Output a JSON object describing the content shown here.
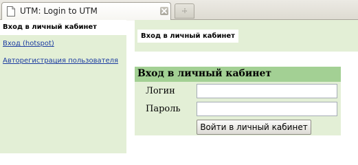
{
  "browser": {
    "tab_title": "UTM: Login to UTM",
    "icons": {
      "tab_icon": "document-icon",
      "close": "close-icon",
      "new_tab": "plus-icon"
    }
  },
  "sidebar": {
    "heading": "Вход в личный кабинет",
    "links": [
      "Вход (hotspot)",
      "Авторегистрация пользователя"
    ]
  },
  "main": {
    "header_title": "Вход в личный кабинет",
    "form": {
      "title": "Вход в личный кабинет",
      "login_label": "Логин",
      "login_value": "",
      "password_label": "Пароль",
      "password_value": "",
      "submit_label": "Войти в личный кабинет"
    }
  },
  "colors": {
    "panel_bg": "#e3efd6",
    "form_header_bg": "#a3d094",
    "link": "#1a3aa0"
  }
}
